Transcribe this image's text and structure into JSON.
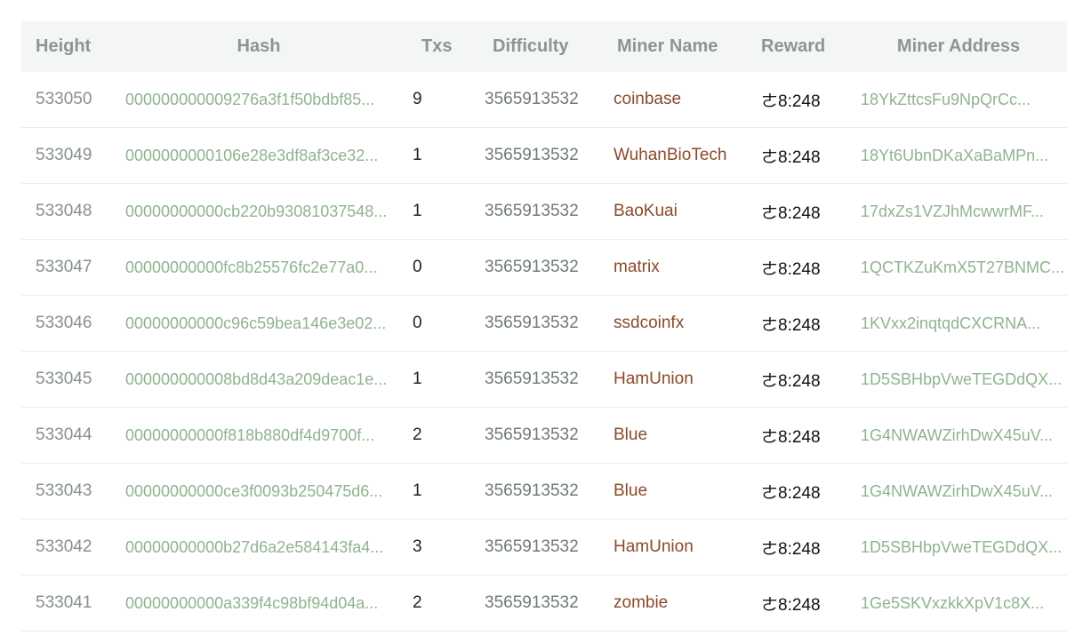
{
  "columns": {
    "height": "Height",
    "hash": "Hash",
    "txs": "Txs",
    "difficulty": "Difficulty",
    "miner_name": "Miner Name",
    "reward": "Reward",
    "miner_address": "Miner Address"
  },
  "rows": [
    {
      "height": "533050",
      "hash": "000000000009276a3f1f50bdbf85...",
      "txs": "9",
      "difficulty": "3565913532",
      "miner": "coinbase",
      "reward": "ㄜ8:248",
      "address": "18YkZttcsFu9NpQrCc..."
    },
    {
      "height": "533049",
      "hash": "0000000000106e28e3df8af3ce32...",
      "txs": "1",
      "difficulty": "3565913532",
      "miner": "WuhanBioTech",
      "reward": "ㄜ8:248",
      "address": "18Yt6UbnDKaXaBaMPn..."
    },
    {
      "height": "533048",
      "hash": "00000000000cb220b93081037548...",
      "txs": "1",
      "difficulty": "3565913532",
      "miner": "BaoKuai",
      "reward": "ㄜ8:248",
      "address": "17dxZs1VZJhMcwwrMF..."
    },
    {
      "height": "533047",
      "hash": "00000000000fc8b25576fc2e77a0...",
      "txs": "0",
      "difficulty": "3565913532",
      "miner": "matrix",
      "reward": "ㄜ8:248",
      "address": "1QCTKZuKmX5T27BNMC..."
    },
    {
      "height": "533046",
      "hash": "00000000000c96c59bea146e3e02...",
      "txs": "0",
      "difficulty": "3565913532",
      "miner": "ssdcoinfx",
      "reward": "ㄜ8:248",
      "address": "1KVxx2inqtqdCXCRNA..."
    },
    {
      "height": "533045",
      "hash": "000000000008bd8d43a209deac1e...",
      "txs": "1",
      "difficulty": "3565913532",
      "miner": "HamUnion",
      "reward": "ㄜ8:248",
      "address": "1D5SBHbpVweTEGDdQX..."
    },
    {
      "height": "533044",
      "hash": "00000000000f818b880df4d9700f...",
      "txs": "2",
      "difficulty": "3565913532",
      "miner": "Blue",
      "reward": "ㄜ8:248",
      "address": "1G4NWAWZirhDwX45uV..."
    },
    {
      "height": "533043",
      "hash": "00000000000ce3f0093b250475d6...",
      "txs": "1",
      "difficulty": "3565913532",
      "miner": "Blue",
      "reward": "ㄜ8:248",
      "address": "1G4NWAWZirhDwX45uV..."
    },
    {
      "height": "533042",
      "hash": "00000000000b27d6a2e584143fa4...",
      "txs": "3",
      "difficulty": "3565913532",
      "miner": "HamUnion",
      "reward": "ㄜ8:248",
      "address": "1D5SBHbpVweTEGDdQX..."
    },
    {
      "height": "533041",
      "hash": "00000000000a339f4c98bf94d04a...",
      "txs": "2",
      "difficulty": "3565913532",
      "miner": "zombie",
      "reward": "ㄜ8:248",
      "address": "1Ge5SKVxzkkXpV1c8X..."
    }
  ]
}
